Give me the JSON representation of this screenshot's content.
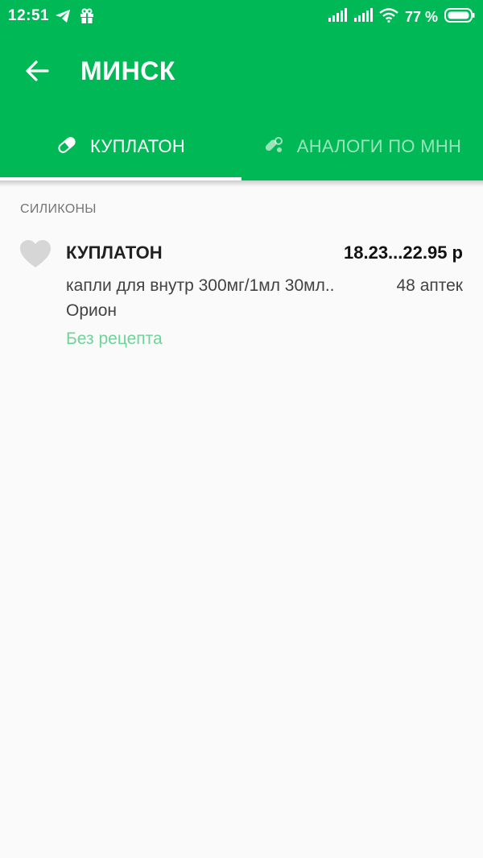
{
  "status_bar": {
    "time": "12:51",
    "battery": "77 %"
  },
  "toolbar": {
    "title": "МИНСК"
  },
  "tabs": [
    {
      "label": "КУПЛАТОН",
      "icon": "pill-icon",
      "active": true
    },
    {
      "label": "АНАЛОГИ ПО МНН",
      "icon": "pills-icon",
      "active": false
    }
  ],
  "section": {
    "header": "СИЛИКОНЫ"
  },
  "drug": {
    "name": "КУПЛАТОН",
    "price": "18.23...22.95 р",
    "form": "капли для внутр 300мг/1мл 30мл..",
    "pharmacies": "48 аптек",
    "manufacturer": "Орион",
    "prescription": "Без рецепта"
  },
  "colors": {
    "brand_green": "#00b956",
    "rx_green": "#6fd49a",
    "background": "#fafafa"
  }
}
